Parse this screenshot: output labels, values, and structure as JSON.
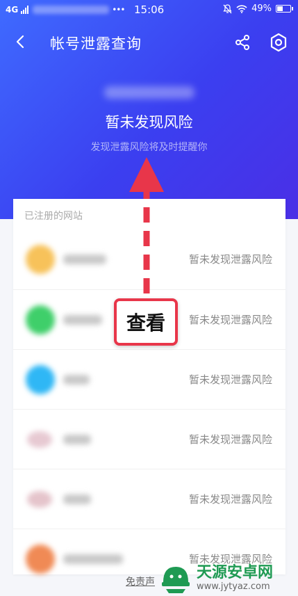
{
  "statusbar": {
    "network": "4G",
    "time": "15:06",
    "battery": "49%",
    "battery_level": 0.49
  },
  "header": {
    "title": "帐号泄露查询"
  },
  "summary": {
    "status": "暂未发现风险",
    "subtitle": "发现泄露风险将及时提醒你"
  },
  "list": {
    "heading": "已注册的网站",
    "items": [
      {
        "status": "暂未发现泄露风险",
        "color": "#f7c25a"
      },
      {
        "status": "暂未发现泄露风险",
        "color": "#3fcf6a"
      },
      {
        "status": "暂未发现泄露风险",
        "color": "#2fb7f5"
      },
      {
        "status": "暂未发现泄露风险",
        "color": "#e7c9d2"
      },
      {
        "status": "暂未发现泄露风险",
        "color": "#e5c4cb"
      },
      {
        "status": "暂未发现泄露风险",
        "color": "#f08a55"
      }
    ]
  },
  "footer": {
    "disclaimer": "免责声"
  },
  "annotation": {
    "label": "查看",
    "color": "#e8364a"
  },
  "watermark": {
    "name": "天源安卓网",
    "url": "www.jytyaz.com"
  }
}
